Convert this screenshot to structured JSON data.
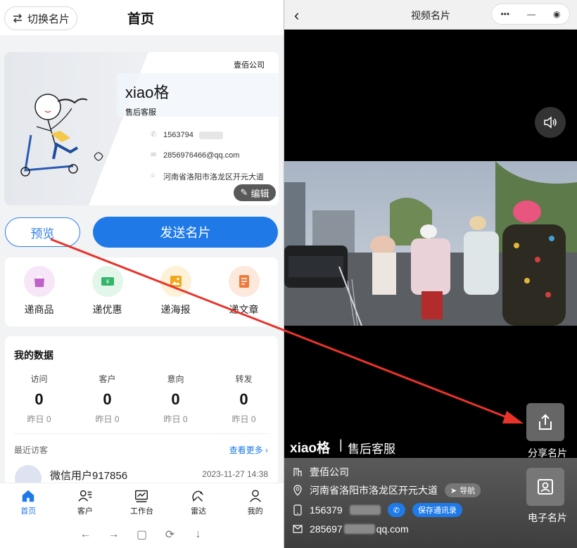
{
  "left": {
    "header": {
      "switch_label": "切换名片",
      "title": "首页"
    },
    "card": {
      "company": "壹佰公司",
      "name": "xiao格",
      "role": "售后客服",
      "phone": "1563794",
      "email": "2856976466@qq.com",
      "address": "河南省洛阳市洛龙区开元大道",
      "edit_label": "编辑"
    },
    "actions": {
      "preview_label": "预览",
      "send_label": "发送名片"
    },
    "tools": [
      {
        "label": "递商品",
        "icon": "bag-icon",
        "color": "#c060c8",
        "bg": "#f6e6f8"
      },
      {
        "label": "递优惠",
        "icon": "coupon-icon",
        "color": "#34b56a",
        "bg": "#e3f6ea"
      },
      {
        "label": "递海报",
        "icon": "poster-icon",
        "color": "#f2a81c",
        "bg": "#fdf1d8"
      },
      {
        "label": "递文章",
        "icon": "article-icon",
        "color": "#ee7a3a",
        "bg": "#fde8dc"
      }
    ],
    "data": {
      "title": "我的数据",
      "stats": [
        {
          "label": "访问",
          "value": "0",
          "yesterday": "昨日 0"
        },
        {
          "label": "客户",
          "value": "0",
          "yesterday": "昨日 0"
        },
        {
          "label": "意向",
          "value": "0",
          "yesterday": "昨日 0"
        },
        {
          "label": "转发",
          "value": "0",
          "yesterday": "昨日 0"
        }
      ],
      "recent_label": "最近访客",
      "see_more": "查看更多 ›",
      "visitor": {
        "name": "微信用户917856",
        "time": "2023-11-27 14:38"
      }
    },
    "tabs": [
      {
        "label": "首页",
        "icon": "home-icon",
        "active": true
      },
      {
        "label": "客户",
        "icon": "customers-icon",
        "active": false
      },
      {
        "label": "工作台",
        "icon": "workbench-icon",
        "active": false
      },
      {
        "label": "雷达",
        "icon": "radar-icon",
        "active": false
      },
      {
        "label": "我的",
        "icon": "profile-icon",
        "active": false
      }
    ],
    "sysnav": [
      "←",
      "→",
      "▢",
      "⟳",
      "↓"
    ]
  },
  "right": {
    "header": {
      "title": "视频名片",
      "capsule_dots": "•••",
      "capsule_min": "—",
      "capsule_close": "◉"
    },
    "name": "xiao格",
    "separator": "|",
    "role": "售后客服",
    "share_label": "分享名片",
    "ecard_label": "电子名片",
    "info": {
      "company": "壹佰公司",
      "address": "河南省洛阳市洛龙区开元大道",
      "navigate_label": "导航",
      "phone": "156379",
      "save_contact_label": "保存通讯录",
      "email_prefix": "285697",
      "email_suffix": "qq.com"
    }
  },
  "colors": {
    "accent": "#1f7ae8",
    "annotation_arrow": "#e8332a"
  }
}
